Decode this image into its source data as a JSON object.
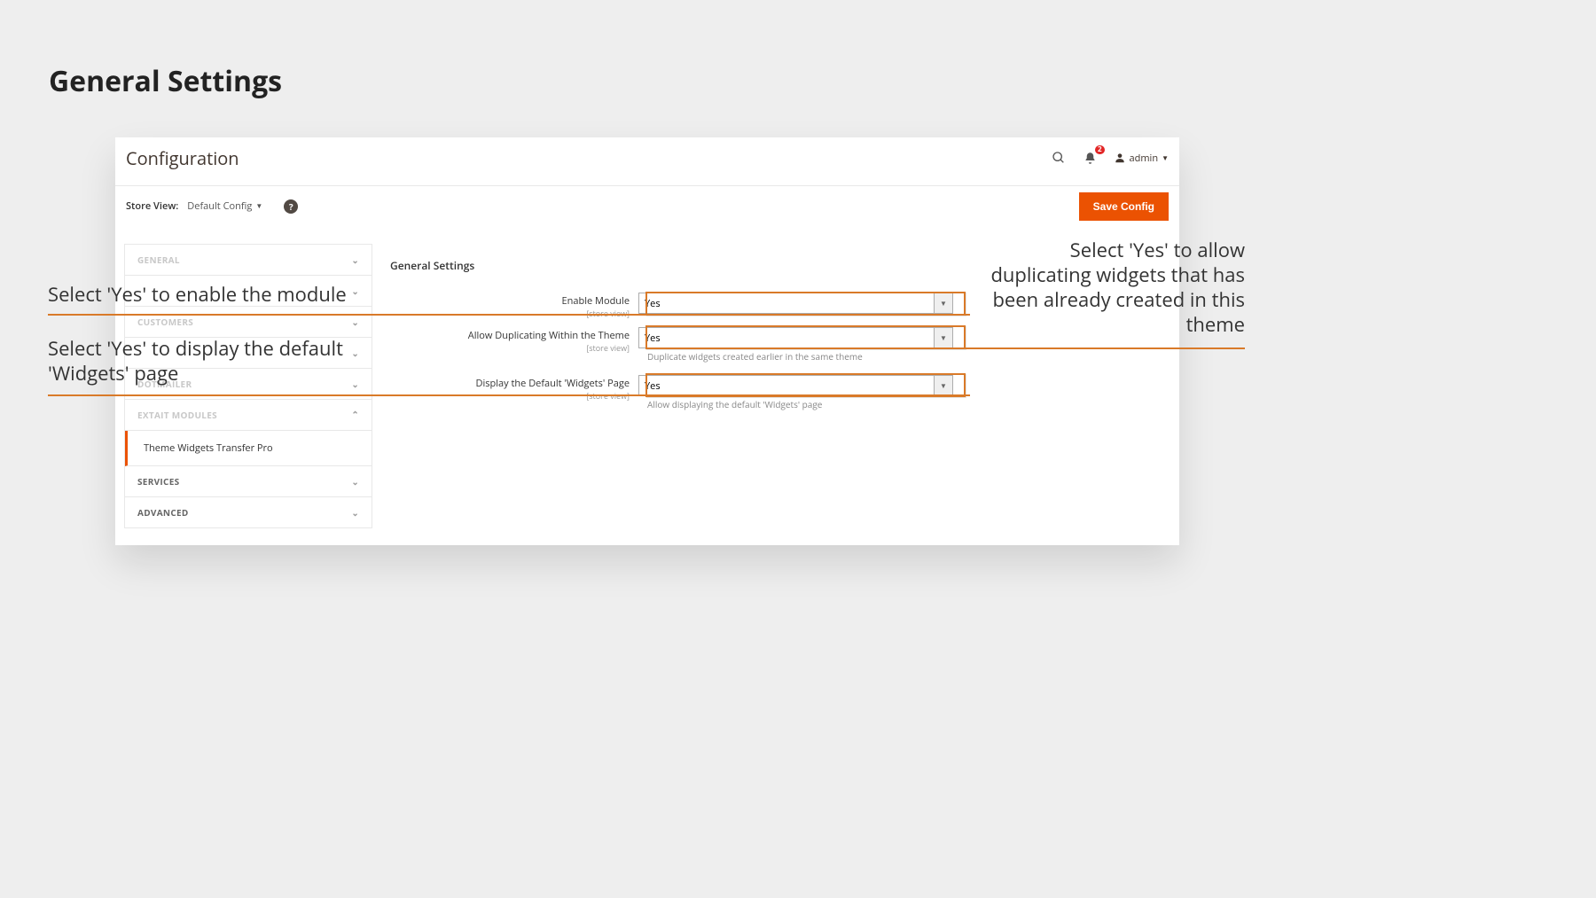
{
  "slide": {
    "title": "General Settings"
  },
  "header": {
    "title": "Configuration",
    "notifications_count": "2",
    "user_label": "admin"
  },
  "toolbar": {
    "store_view_label": "Store View:",
    "store_view_value": "Default Config",
    "save_label": "Save Config"
  },
  "sidebar": {
    "groups": [
      {
        "label": "General",
        "faded": true,
        "expanded": false
      },
      {
        "label": "Customers",
        "faded": true,
        "expanded": false
      },
      {
        "label": "Dotmailer",
        "faded": true,
        "expanded": false
      },
      {
        "label": "Extait Modules",
        "faded": true,
        "expanded": true
      },
      {
        "label": "Services",
        "faded": false,
        "expanded": false
      },
      {
        "label": "Advanced",
        "faded": false,
        "expanded": false
      }
    ],
    "active_item": "Theme Widgets Transfer Pro",
    "hidden_blank": ""
  },
  "main": {
    "section_title": "General Settings",
    "fields": [
      {
        "label": "Enable Module",
        "scope": "[store view]",
        "value": "Yes"
      },
      {
        "label": "Allow Duplicating Within the Theme",
        "scope": "[store view]",
        "value": "Yes",
        "note": "Duplicate widgets created earlier in the same theme"
      },
      {
        "label": "Display the Default 'Widgets' Page",
        "scope": "[store view]",
        "value": "Yes",
        "note": "Allow displaying the default 'Widgets' page"
      }
    ]
  },
  "callouts": {
    "left1": "Select 'Yes' to enable the module",
    "left2": "Select 'Yes' to display the default 'Widgets' page",
    "right1": "Select 'Yes' to allow duplicating widgets that has been already created in this theme"
  }
}
